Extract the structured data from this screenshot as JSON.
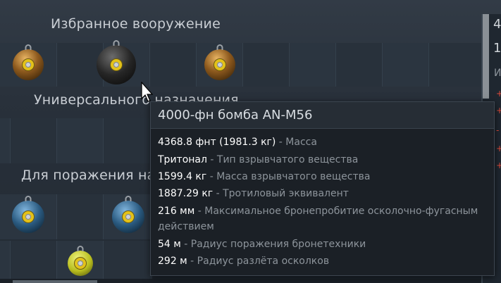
{
  "sections": {
    "favorite": "Избранное вооружение",
    "general": "Универсального назначения",
    "armor": "Для поражения наз"
  },
  "icons": {
    "row1": [
      "gold-bomb-icon",
      "dark-bomb-icon",
      "gold-bomb-icon"
    ],
    "row3": [
      "blue-bomb-icon",
      "blue-bomb-icon"
    ],
    "row4": [
      "yellow-bomb-icon"
    ]
  },
  "side_panel": {
    "char1": "4",
    "char2": "1",
    "char3": "И"
  },
  "tooltip": {
    "title": "4000-фн бомба AN-M56",
    "rows": [
      {
        "value": "4368.8 фнт (1981.3 кг)",
        "label": " - Масса"
      },
      {
        "value": "Тритонал",
        "label": " - Тип взрывчатого вещества"
      },
      {
        "value": "1599.4 кг",
        "label": " - Масса взрывчатого вещества"
      },
      {
        "value": "1887.29 кг",
        "label": " - Тротиловый эквивалент"
      },
      {
        "value": "216 мм",
        "label": " - Максимальное бронепробитие осколочно-фугасным действием"
      },
      {
        "value": "54 м",
        "label": " - Радиус поражения бронетехники"
      },
      {
        "value": "292 м",
        "label": " - Радиус разлёта осколков"
      }
    ]
  },
  "colors": {
    "accent_yellow": "#e3c21a",
    "value_text": "#ffffff",
    "label_text": "#8d949b"
  }
}
